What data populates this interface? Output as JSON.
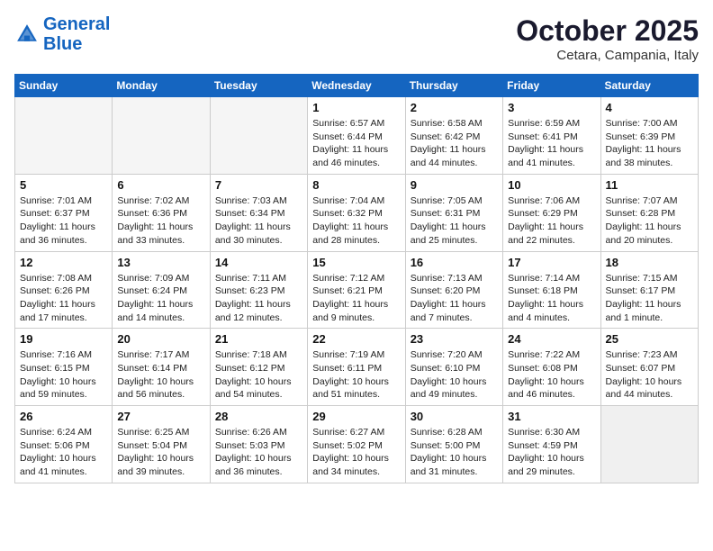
{
  "logo": {
    "line1": "General",
    "line2": "Blue"
  },
  "title": "October 2025",
  "location": "Cetara, Campania, Italy",
  "days_of_week": [
    "Sunday",
    "Monday",
    "Tuesday",
    "Wednesday",
    "Thursday",
    "Friday",
    "Saturday"
  ],
  "weeks": [
    [
      {
        "day": "",
        "info": ""
      },
      {
        "day": "",
        "info": ""
      },
      {
        "day": "",
        "info": ""
      },
      {
        "day": "1",
        "info": "Sunrise: 6:57 AM\nSunset: 6:44 PM\nDaylight: 11 hours\nand 46 minutes."
      },
      {
        "day": "2",
        "info": "Sunrise: 6:58 AM\nSunset: 6:42 PM\nDaylight: 11 hours\nand 44 minutes."
      },
      {
        "day": "3",
        "info": "Sunrise: 6:59 AM\nSunset: 6:41 PM\nDaylight: 11 hours\nand 41 minutes."
      },
      {
        "day": "4",
        "info": "Sunrise: 7:00 AM\nSunset: 6:39 PM\nDaylight: 11 hours\nand 38 minutes."
      }
    ],
    [
      {
        "day": "5",
        "info": "Sunrise: 7:01 AM\nSunset: 6:37 PM\nDaylight: 11 hours\nand 36 minutes."
      },
      {
        "day": "6",
        "info": "Sunrise: 7:02 AM\nSunset: 6:36 PM\nDaylight: 11 hours\nand 33 minutes."
      },
      {
        "day": "7",
        "info": "Sunrise: 7:03 AM\nSunset: 6:34 PM\nDaylight: 11 hours\nand 30 minutes."
      },
      {
        "day": "8",
        "info": "Sunrise: 7:04 AM\nSunset: 6:32 PM\nDaylight: 11 hours\nand 28 minutes."
      },
      {
        "day": "9",
        "info": "Sunrise: 7:05 AM\nSunset: 6:31 PM\nDaylight: 11 hours\nand 25 minutes."
      },
      {
        "day": "10",
        "info": "Sunrise: 7:06 AM\nSunset: 6:29 PM\nDaylight: 11 hours\nand 22 minutes."
      },
      {
        "day": "11",
        "info": "Sunrise: 7:07 AM\nSunset: 6:28 PM\nDaylight: 11 hours\nand 20 minutes."
      }
    ],
    [
      {
        "day": "12",
        "info": "Sunrise: 7:08 AM\nSunset: 6:26 PM\nDaylight: 11 hours\nand 17 minutes."
      },
      {
        "day": "13",
        "info": "Sunrise: 7:09 AM\nSunset: 6:24 PM\nDaylight: 11 hours\nand 14 minutes."
      },
      {
        "day": "14",
        "info": "Sunrise: 7:11 AM\nSunset: 6:23 PM\nDaylight: 11 hours\nand 12 minutes."
      },
      {
        "day": "15",
        "info": "Sunrise: 7:12 AM\nSunset: 6:21 PM\nDaylight: 11 hours\nand 9 minutes."
      },
      {
        "day": "16",
        "info": "Sunrise: 7:13 AM\nSunset: 6:20 PM\nDaylight: 11 hours\nand 7 minutes."
      },
      {
        "day": "17",
        "info": "Sunrise: 7:14 AM\nSunset: 6:18 PM\nDaylight: 11 hours\nand 4 minutes."
      },
      {
        "day": "18",
        "info": "Sunrise: 7:15 AM\nSunset: 6:17 PM\nDaylight: 11 hours\nand 1 minute."
      }
    ],
    [
      {
        "day": "19",
        "info": "Sunrise: 7:16 AM\nSunset: 6:15 PM\nDaylight: 10 hours\nand 59 minutes."
      },
      {
        "day": "20",
        "info": "Sunrise: 7:17 AM\nSunset: 6:14 PM\nDaylight: 10 hours\nand 56 minutes."
      },
      {
        "day": "21",
        "info": "Sunrise: 7:18 AM\nSunset: 6:12 PM\nDaylight: 10 hours\nand 54 minutes."
      },
      {
        "day": "22",
        "info": "Sunrise: 7:19 AM\nSunset: 6:11 PM\nDaylight: 10 hours\nand 51 minutes."
      },
      {
        "day": "23",
        "info": "Sunrise: 7:20 AM\nSunset: 6:10 PM\nDaylight: 10 hours\nand 49 minutes."
      },
      {
        "day": "24",
        "info": "Sunrise: 7:22 AM\nSunset: 6:08 PM\nDaylight: 10 hours\nand 46 minutes."
      },
      {
        "day": "25",
        "info": "Sunrise: 7:23 AM\nSunset: 6:07 PM\nDaylight: 10 hours\nand 44 minutes."
      }
    ],
    [
      {
        "day": "26",
        "info": "Sunrise: 6:24 AM\nSunset: 5:06 PM\nDaylight: 10 hours\nand 41 minutes."
      },
      {
        "day": "27",
        "info": "Sunrise: 6:25 AM\nSunset: 5:04 PM\nDaylight: 10 hours\nand 39 minutes."
      },
      {
        "day": "28",
        "info": "Sunrise: 6:26 AM\nSunset: 5:03 PM\nDaylight: 10 hours\nand 36 minutes."
      },
      {
        "day": "29",
        "info": "Sunrise: 6:27 AM\nSunset: 5:02 PM\nDaylight: 10 hours\nand 34 minutes."
      },
      {
        "day": "30",
        "info": "Sunrise: 6:28 AM\nSunset: 5:00 PM\nDaylight: 10 hours\nand 31 minutes."
      },
      {
        "day": "31",
        "info": "Sunrise: 6:30 AM\nSunset: 4:59 PM\nDaylight: 10 hours\nand 29 minutes."
      },
      {
        "day": "",
        "info": ""
      }
    ]
  ]
}
